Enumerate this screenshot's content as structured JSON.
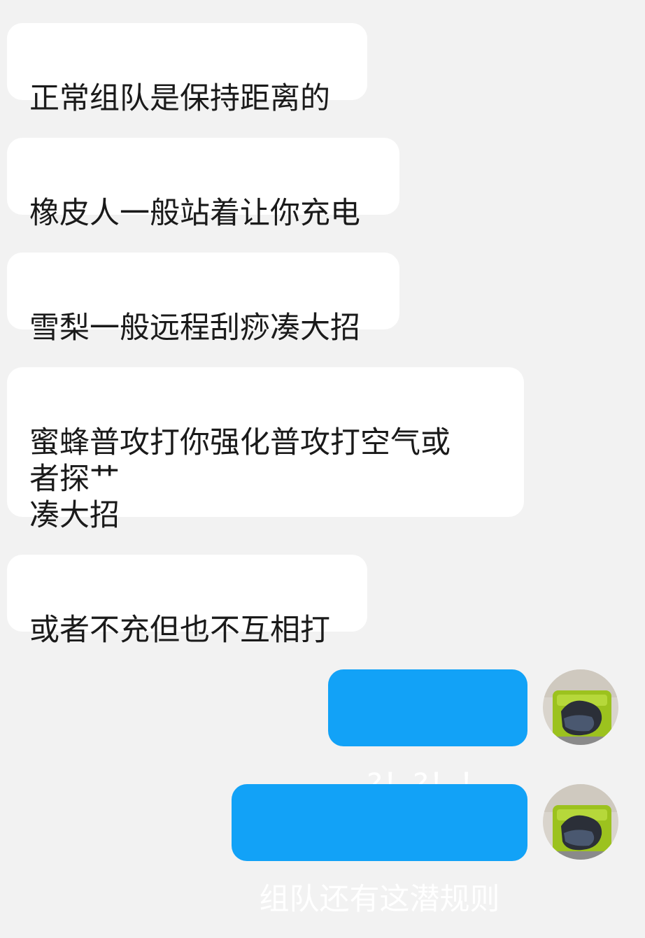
{
  "messages": [
    {
      "direction": "incoming",
      "text": "正常组队是保持距离的"
    },
    {
      "direction": "incoming",
      "text": "橡皮人一般站着让你充电"
    },
    {
      "direction": "incoming",
      "text": "雪梨一般远程刮痧凑大招"
    },
    {
      "direction": "incoming",
      "text": "蜜蜂普攻打你强化普攻打空气或\n者探艹\n凑大招"
    },
    {
      "direction": "incoming",
      "text": "或者不充但也不互相打"
    },
    {
      "direction": "outgoing",
      "text": "?！?！！"
    },
    {
      "direction": "outgoing",
      "text": "组队还有这潜规则"
    }
  ],
  "colors": {
    "background": "#f2f2f2",
    "incoming_bubble": "#ffffff",
    "outgoing_bubble": "#12a2f7",
    "outgoing_text": "#ffffff"
  },
  "icons": {
    "avatar": "user-avatar-photo"
  }
}
